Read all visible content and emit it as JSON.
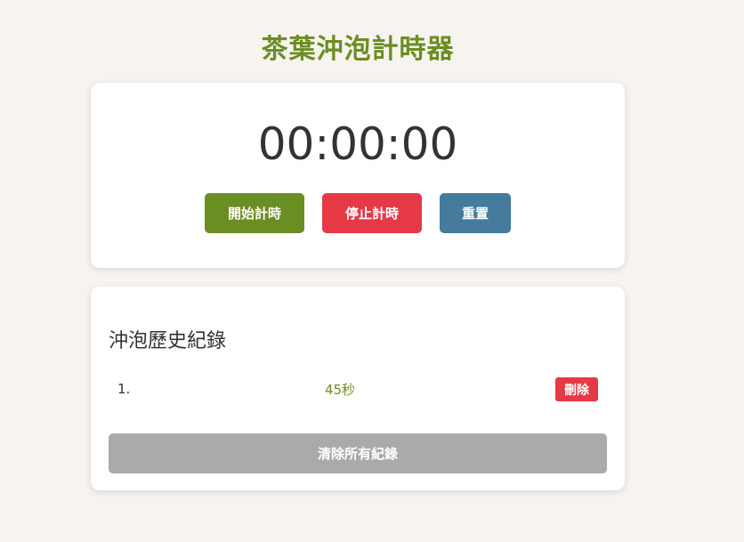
{
  "app": {
    "title": "茶葉沖泡計時器"
  },
  "timer": {
    "display": "00:00:00",
    "start_label": "開始計時",
    "stop_label": "停止計時",
    "reset_label": "重置"
  },
  "history": {
    "title": "沖泡歷史紀錄",
    "records": [
      {
        "index": "1.",
        "duration": "45秒",
        "delete_label": "刪除"
      }
    ],
    "clear_label": "清除所有紀錄"
  },
  "colors": {
    "background": "#f7f3ef",
    "accent": "#6b8e23",
    "danger": "#e63946",
    "reset": "#457b9d",
    "disabled": "#aaaaaa"
  }
}
